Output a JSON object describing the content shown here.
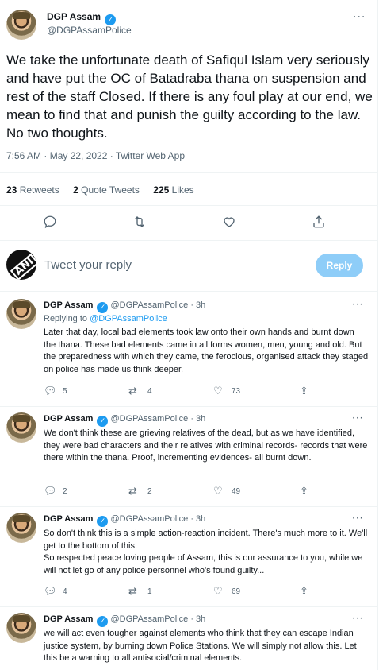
{
  "main_tweet": {
    "author_name": "DGP Assam",
    "verified_mark": "✓",
    "handle": "@DGPAssamPolice",
    "more_icon": "···",
    "text": "We take the unfortunate death of Safiqul Islam very seriously and have put the OC of Batadraba thana on suspension and rest of the staff Closed. If there is any foul play at our end, we mean to find that and punish the guilty according to the law. No two thoughts.",
    "timestamp": "7:56 AM · May 22, 2022 · Twitter Web App",
    "retweets_count": "23",
    "retweets_label": "Retweets",
    "quotes_count": "2",
    "quotes_label": "Quote Tweets",
    "likes_count": "225",
    "likes_label": "Likes"
  },
  "icons": {
    "reply": "reply-icon",
    "retweet": "retweet-icon",
    "like": "heart-icon",
    "share": "share-icon"
  },
  "composer": {
    "avatar_text": "ANI",
    "placeholder": "Tweet your reply",
    "button_label": "Reply"
  },
  "replies": [
    {
      "author_name": "DGP Assam",
      "handle": "@DGPAssamPolice",
      "time": "· 3h",
      "replying_prefix": "Replying to",
      "replying_to": "@DGPAssamPolice",
      "text": "Later that day, local bad elements took law onto their own hands and burnt down the thana. These bad elements came in all forms women, men, young and old. But the preparedness with which they came, the ferocious, organised attack they staged on police has made us think deeper.",
      "reply_count": "5",
      "retweet_count": "4",
      "like_count": "73"
    },
    {
      "author_name": "DGP Assam",
      "handle": "@DGPAssamPolice",
      "time": "· 3h",
      "text": "We don't think these are grieving relatives of the dead, but as we have identified, they were bad characters and their relatives with criminal records- records that were there within the thana. Proof, incrementing evidences- all burnt down.",
      "reply_count": "2",
      "retweet_count": "2",
      "like_count": "49"
    },
    {
      "author_name": "DGP Assam",
      "handle": "@DGPAssamPolice",
      "time": "· 3h",
      "text": "So don't think this is a simple action-reaction incident. There's much more to it. We'll get to the bottom of this.\nSo respected peace loving people of Assam, this is our assurance to you, while we will not let go of any police personnel who's found guilty...",
      "reply_count": "4",
      "retweet_count": "1",
      "like_count": "69"
    },
    {
      "author_name": "DGP Assam",
      "handle": "@DGPAssamPolice",
      "time": "· 3h",
      "text": "we will act even tougher against elements who think that they can escape Indian justice system, by burning down Police Stations. We will simply not allow this. Let this be a warning to all antisocial/criminal elements."
    }
  ],
  "colors": {
    "accent": "#1d9bf0",
    "reply_button_disabled": "#8ecdf8",
    "secondary_text": "#536471",
    "divider": "#eff3f4"
  }
}
